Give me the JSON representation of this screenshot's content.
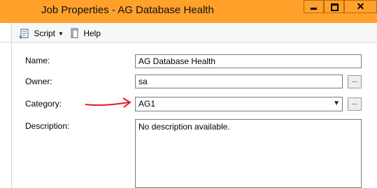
{
  "window": {
    "title": "Job Properties - AG Database Health",
    "close_glyph": "✕"
  },
  "toolbar": {
    "script_label": "Script",
    "dropdown_glyph": "▼",
    "help_label": "Help"
  },
  "form": {
    "name_label": "Name:",
    "name_value": "AG Database Health",
    "owner_label": "Owner:",
    "owner_value": "sa",
    "owner_browse": "...",
    "category_label": "Category:",
    "category_value": "AG1",
    "category_browse": "...",
    "description_label": "Description:",
    "description_value": "No description available."
  },
  "colors": {
    "titlebar": "#ffa12b",
    "annotation_arrow": "#e8191a"
  }
}
